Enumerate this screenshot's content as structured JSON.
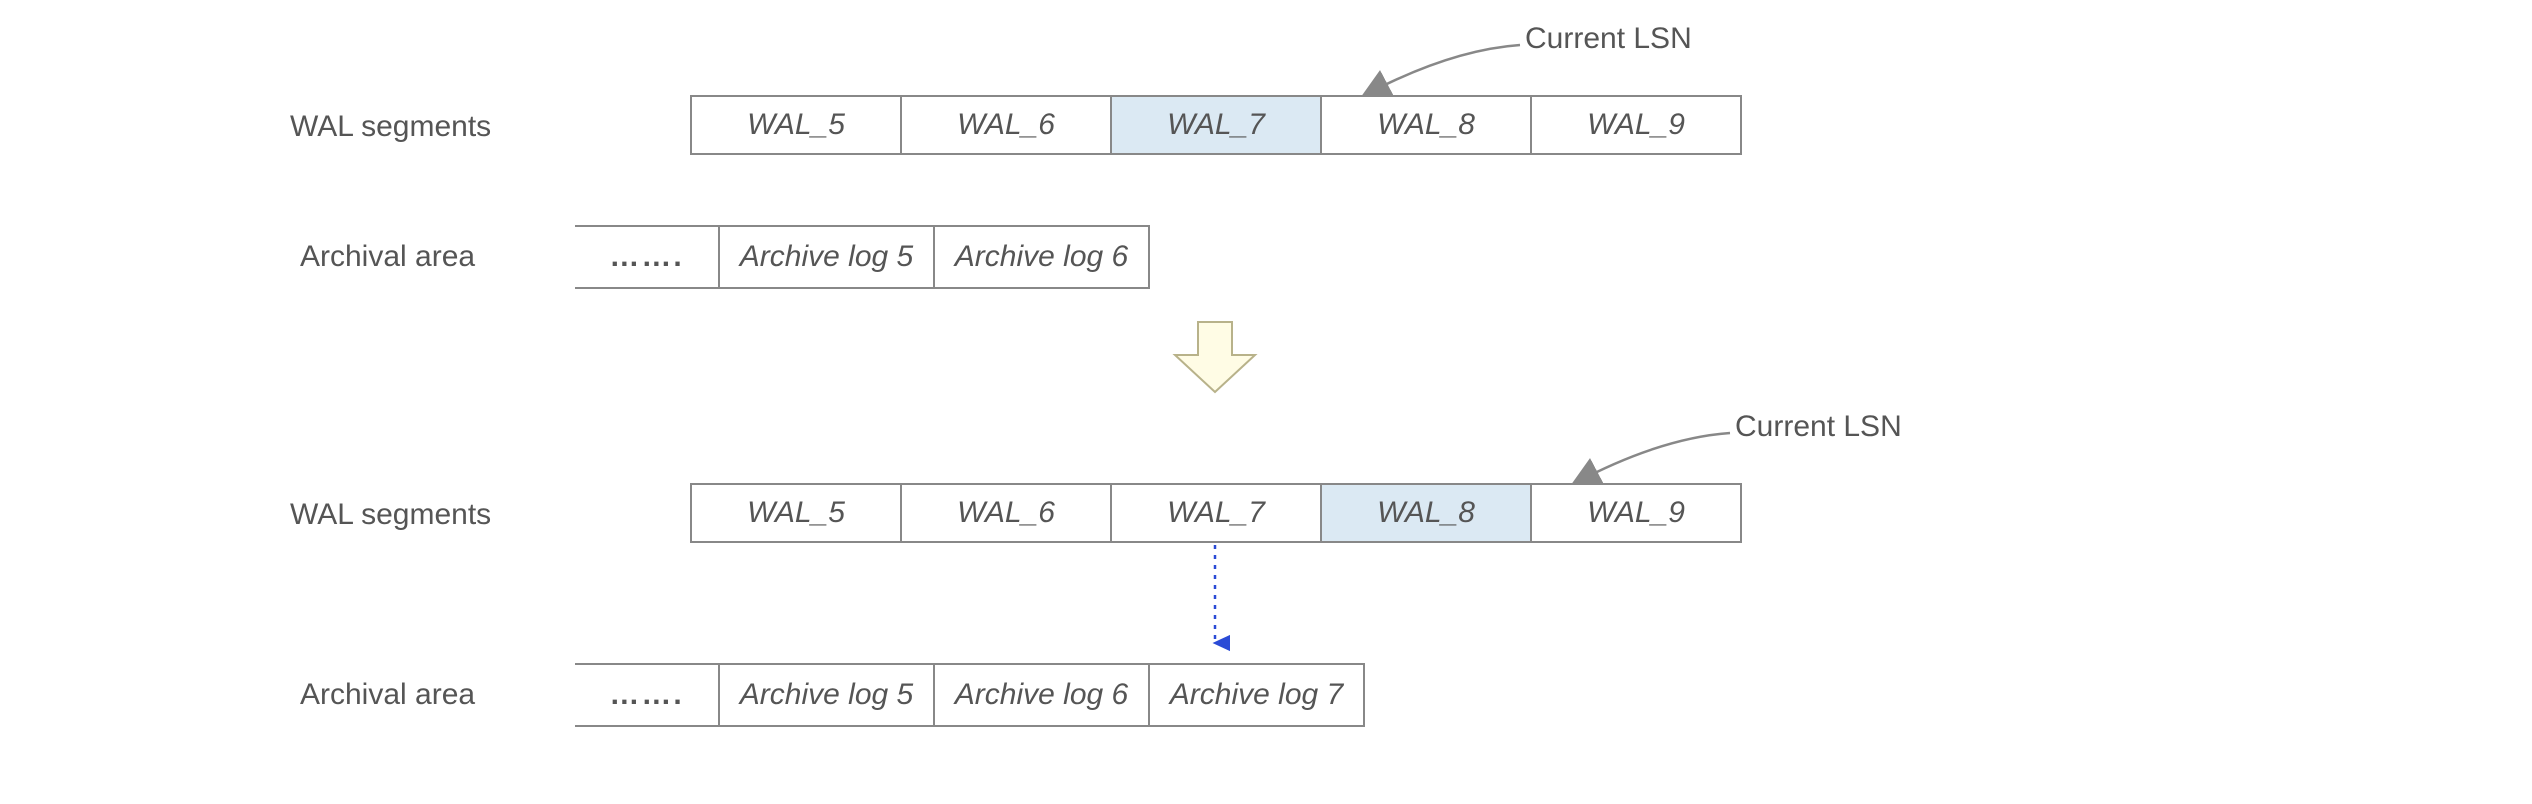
{
  "labels": {
    "wal_segments": "WAL segments",
    "archival_area": "Archival area",
    "current_lsn": "Current LSN",
    "ellipsis": "……."
  },
  "top": {
    "wal": [
      "WAL_5",
      "WAL_6",
      "WAL_7",
      "WAL_8",
      "WAL_9"
    ],
    "highlight_index": 2,
    "archive": [
      "Archive log 5",
      "Archive log 6"
    ]
  },
  "bottom": {
    "wal": [
      "WAL_5",
      "WAL_6",
      "WAL_7",
      "WAL_8",
      "WAL_9"
    ],
    "highlight_index": 3,
    "archive": [
      "Archive log 5",
      "Archive log 6",
      "Archive log 7"
    ]
  },
  "colors": {
    "highlight": "#dbe9f3",
    "border": "#888888",
    "text": "#555555",
    "big_arrow_fill": "#fffce5",
    "dashed_arrow": "#2b4bd6"
  }
}
